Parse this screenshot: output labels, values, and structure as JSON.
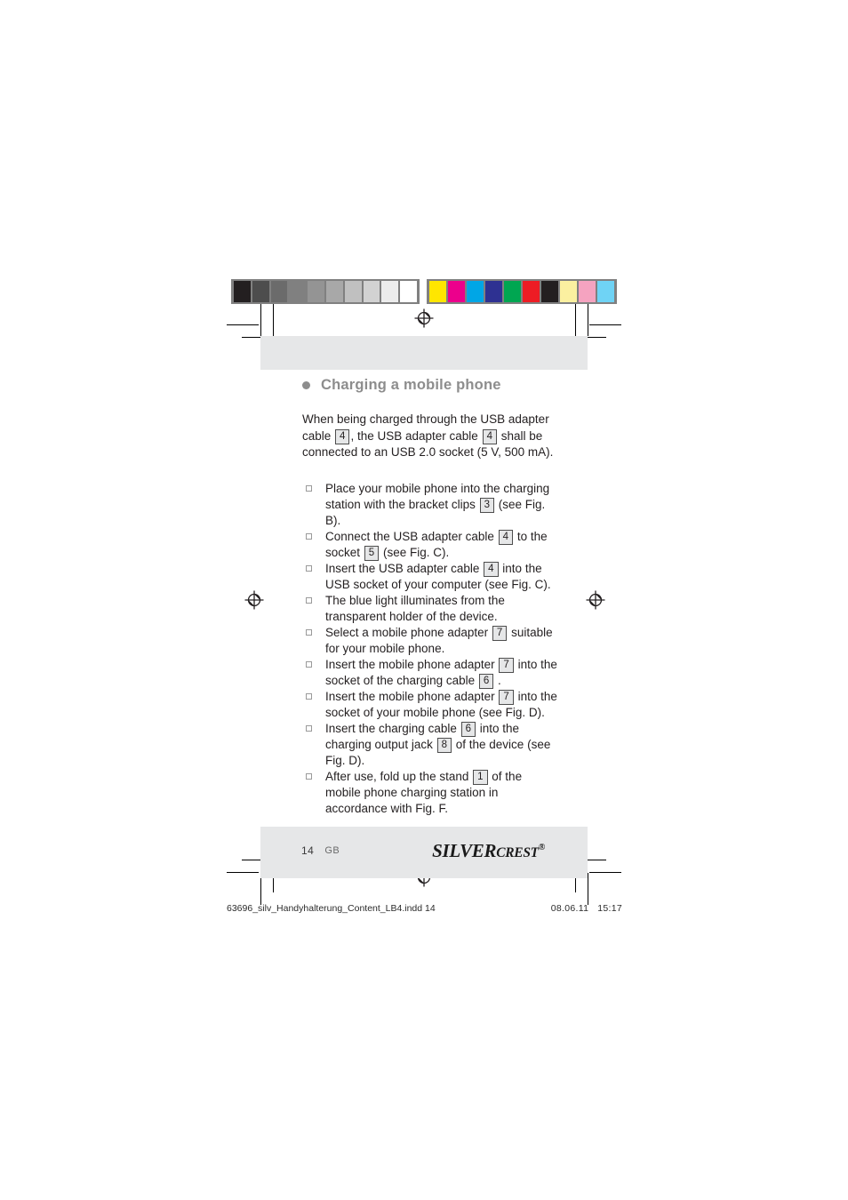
{
  "print_marks": {
    "gray_bar": {
      "name": "grayscale-calibration-bar",
      "swatches": [
        "#231f20",
        "#4d4d4d",
        "#6b6b6b",
        "#808080",
        "#949494",
        "#a8a8a8",
        "#c0c0c0",
        "#d2d2d2",
        "#ececec",
        "#ffffff"
      ]
    },
    "color_bar": {
      "name": "color-calibration-bar",
      "swatches": [
        "#ffe600",
        "#ec008c",
        "#00a6e6",
        "#2e3192",
        "#00a651",
        "#ed1c24",
        "#231f20",
        "#fbf0a0",
        "#f5a3c0",
        "#6fd3f5"
      ]
    },
    "registration_mark_label": "registration-target"
  },
  "page": {
    "heading": "Charging a mobile phone",
    "intro": {
      "part1": "When being charged through the USB adapter cable",
      "ref1": "4",
      "part2": ", the USB adapter cable",
      "ref2": "4",
      "part3": "shall be connected to an USB 2.0 socket (5 V, 500 mA)."
    },
    "steps": [
      {
        "segments": [
          {
            "type": "text",
            "value": "Place your mobile phone into the charging station with the bracket clips"
          },
          {
            "type": "ref",
            "value": "3"
          },
          {
            "type": "text",
            "value": "(see Fig. B)."
          }
        ]
      },
      {
        "segments": [
          {
            "type": "text",
            "value": "Connect the USB adapter cable"
          },
          {
            "type": "ref",
            "value": "4"
          },
          {
            "type": "text",
            "value": "to the socket"
          },
          {
            "type": "ref",
            "value": "5"
          },
          {
            "type": "text",
            "value": "(see Fig. C)."
          }
        ]
      },
      {
        "segments": [
          {
            "type": "text",
            "value": "Insert the USB adapter cable"
          },
          {
            "type": "ref",
            "value": "4"
          },
          {
            "type": "text",
            "value": "into the USB socket of your computer (see Fig. C)."
          }
        ]
      },
      {
        "segments": [
          {
            "type": "text",
            "value": "The blue light illuminates from the transparent holder of the device."
          }
        ]
      },
      {
        "segments": [
          {
            "type": "text",
            "value": "Select a mobile phone adapter"
          },
          {
            "type": "ref",
            "value": "7"
          },
          {
            "type": "text",
            "value": "suitable for your mobile phone."
          }
        ]
      },
      {
        "segments": [
          {
            "type": "text",
            "value": "Insert the mobile phone adapter"
          },
          {
            "type": "ref",
            "value": "7"
          },
          {
            "type": "text",
            "value": "into the socket of the charging cable"
          },
          {
            "type": "ref",
            "value": "6"
          },
          {
            "type": "text",
            "value": "."
          }
        ]
      },
      {
        "segments": [
          {
            "type": "text",
            "value": "Insert the mobile phone adapter"
          },
          {
            "type": "ref",
            "value": "7"
          },
          {
            "type": "text",
            "value": "into the socket of your mobile phone (see Fig. D)."
          }
        ]
      },
      {
        "segments": [
          {
            "type": "text",
            "value": "Insert the charging cable"
          },
          {
            "type": "ref",
            "value": "6"
          },
          {
            "type": "text",
            "value": "into the charging output jack"
          },
          {
            "type": "ref",
            "value": "8"
          },
          {
            "type": "text",
            "value": "of the device (see Fig. D)."
          }
        ]
      },
      {
        "segments": [
          {
            "type": "text",
            "value": "After use, fold up the stand"
          },
          {
            "type": "ref",
            "value": "1"
          },
          {
            "type": "text",
            "value": "of the mobile phone charging station in accordance with Fig. F."
          }
        ]
      }
    ]
  },
  "footer": {
    "page_number": "14",
    "locale_code": "GB",
    "brand": {
      "silver": "SILVER",
      "crest": "CREST",
      "registered": "®"
    }
  },
  "slugline": {
    "file": "63696_silv_Handyhalterung_Content_LB4.indd   14",
    "date": "08.06.11",
    "time": "15:17"
  }
}
